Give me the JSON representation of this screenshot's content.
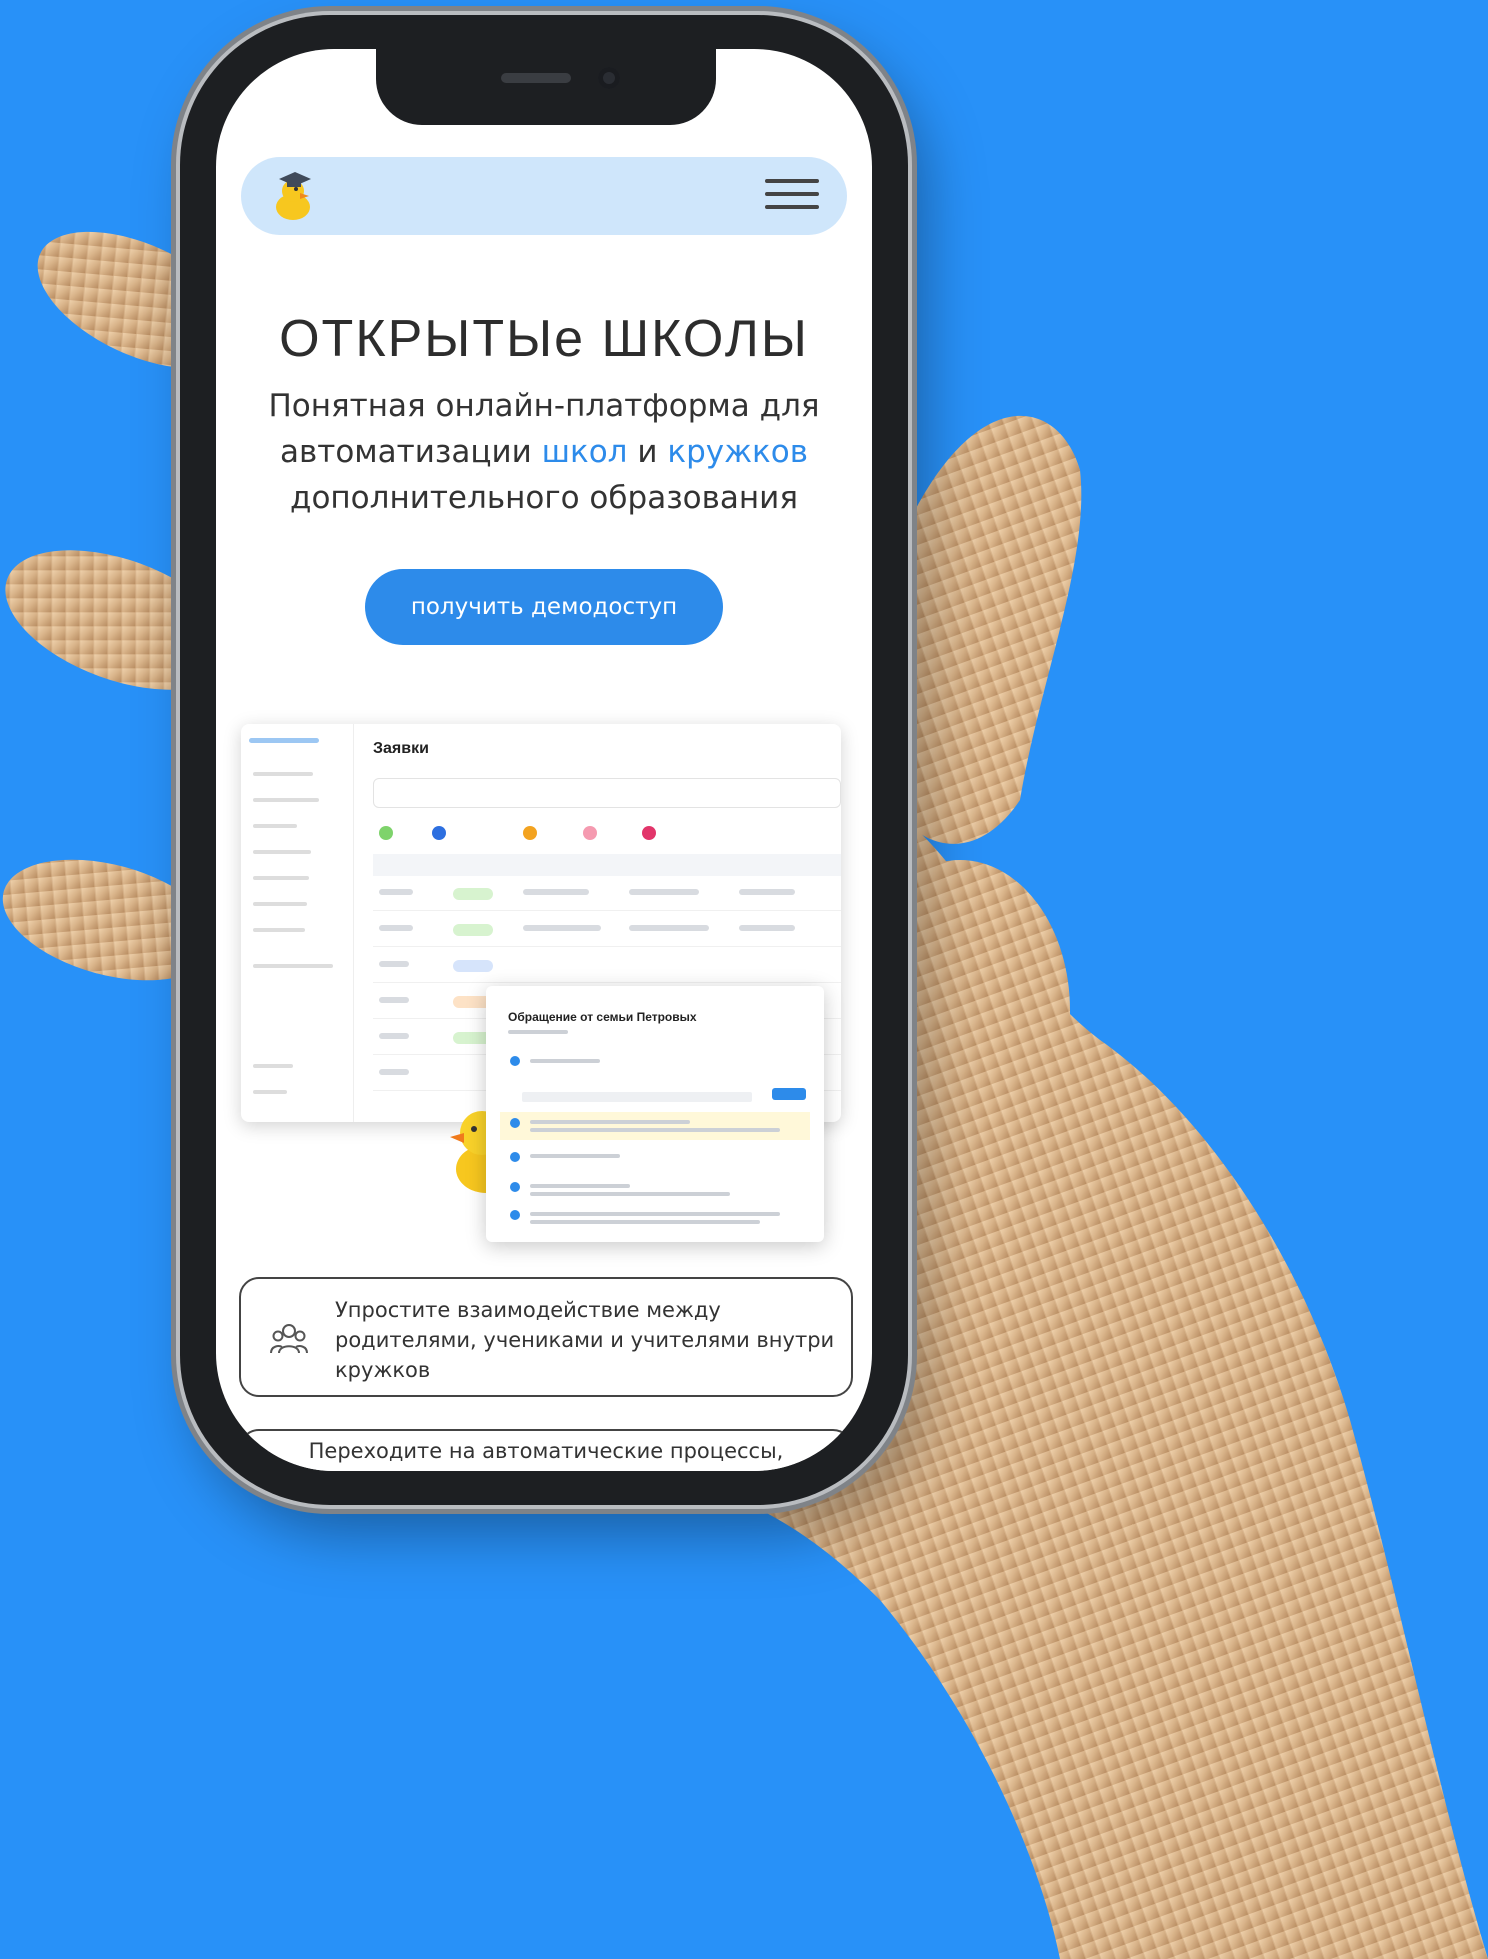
{
  "colors": {
    "background": "#2891f8",
    "accent": "#2d8bea",
    "nav_bg": "#cfe6fb",
    "wood": "#d9b48a"
  },
  "header": {
    "logo_icon": "duck-graduate-logo-icon",
    "menu_icon": "hamburger-menu-icon"
  },
  "hero": {
    "title": "ОТКРЫТЫе ШКОЛЫ",
    "subtitle_line1": "Понятная онлайн-платформа для",
    "subtitle_line2_pre": "автоматизации ",
    "subtitle_accent1": "школ",
    "subtitle_mid": " и ",
    "subtitle_accent2": "кружков",
    "subtitle_line3": "дополнительного образования",
    "cta_label": "получить демодоступ"
  },
  "mockup": {
    "page_title": "Заявки",
    "popup_title": "Обращение от семьи Петровых"
  },
  "features": [
    {
      "icon": "people-group-icon",
      "text": "Упростите взаимодействие между родителями, учениками и учителями внутри кружков"
    },
    {
      "text": "Переходите на автоматические процессы,"
    }
  ]
}
